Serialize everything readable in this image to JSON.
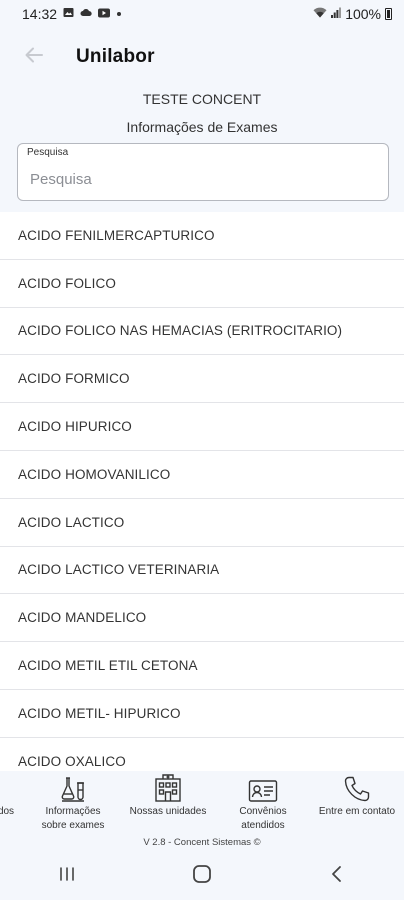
{
  "status_bar": {
    "time": "14:32",
    "battery": "100%",
    "icons": [
      "image-icon",
      "cloud-icon",
      "youtube-icon",
      "dot-icon",
      "wifi-icon",
      "signal-icon",
      "battery-icon"
    ]
  },
  "app_bar": {
    "title": "Unilabor",
    "back_icon": "back-arrow-icon"
  },
  "header": {
    "company": "TESTE CONCENT",
    "section_title": "Informações de Exames"
  },
  "search": {
    "label": "Pesquisa",
    "placeholder": "Pesquisa",
    "value": ""
  },
  "exams": [
    "ACIDO FENILMERCAPTURICO",
    "ACIDO FOLICO",
    "ACIDO FOLICO NAS HEMACIAS (ERITROCITARIO)",
    "ACIDO FORMICO",
    "ACIDO HIPURICO",
    "ACIDO HOMOVANILICO",
    "ACIDO LACTICO",
    "ACIDO LACTICO VETERINARIA",
    "ACIDO MANDELICO",
    "ACIDO METIL ETIL CETONA",
    "ACIDO METIL- HIPURICO",
    "ACIDO OXALICO"
  ],
  "bottom_nav": {
    "items": [
      {
        "label": "dos",
        "icon": "results-icon"
      },
      {
        "label": "Informações\nsobre exames",
        "icon": "lab-flask-icon"
      },
      {
        "label": "Nossas unidades",
        "icon": "building-icon"
      },
      {
        "label": "Convênios\natendidos",
        "icon": "id-card-icon"
      },
      {
        "label": "Entre em contato",
        "icon": "phone-icon"
      }
    ],
    "version": "V 2.8 - Concent Sistemas ©"
  },
  "system_nav": {
    "icons": [
      "recent-apps-icon",
      "home-icon",
      "back-icon"
    ]
  },
  "colors": {
    "background": "#f4f7fc",
    "list_background": "#ffffff",
    "divider": "#e3e4e8",
    "text": "#333333"
  }
}
